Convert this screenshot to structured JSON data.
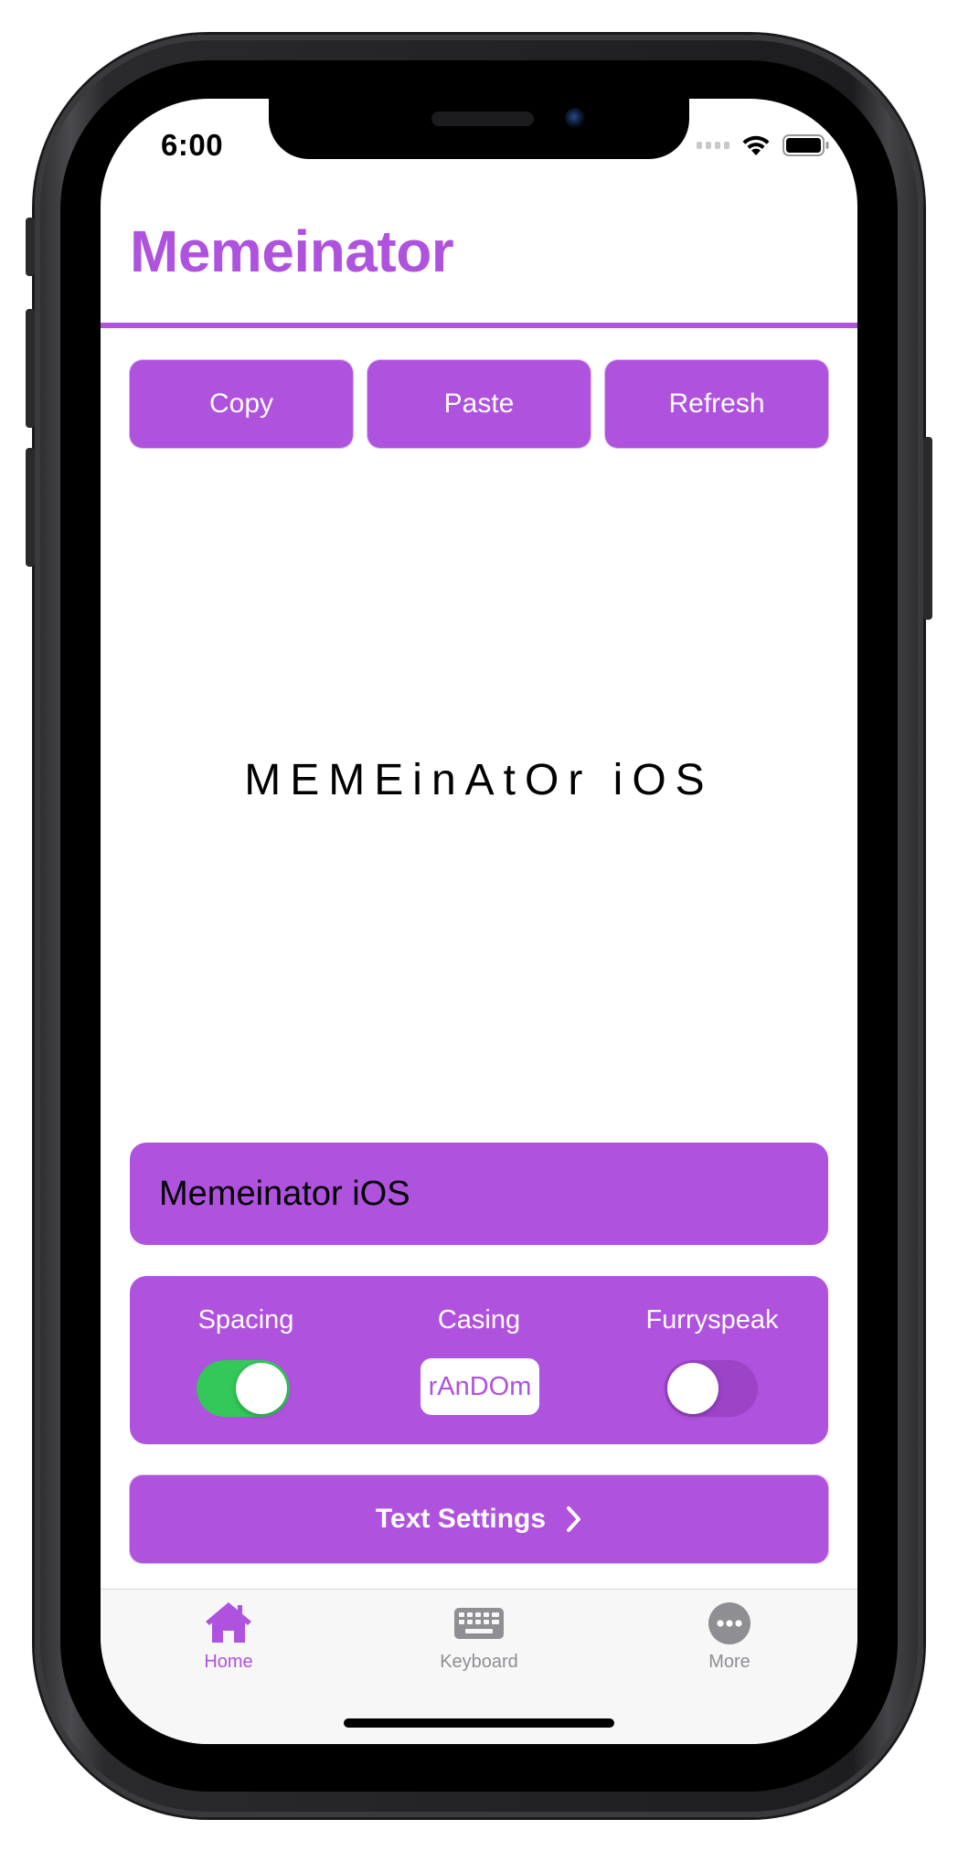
{
  "status_bar": {
    "time": "6:00"
  },
  "app": {
    "title": "Memeinator",
    "accent_color": "#af52de"
  },
  "actions": {
    "copy_label": "Copy",
    "paste_label": "Paste",
    "refresh_label": "Refresh"
  },
  "output": {
    "meme_text": "MEMEinAtOr iOS"
  },
  "input": {
    "value": "Memeinator iOS"
  },
  "options": {
    "spacing": {
      "label": "Spacing",
      "enabled": true,
      "on_color": "#34c759"
    },
    "casing": {
      "label": "Casing",
      "value": "rAnDOm"
    },
    "furryspeak": {
      "label": "Furryspeak",
      "enabled": false
    }
  },
  "settings_button": {
    "label": "Text Settings",
    "icon": "chevron-right-icon"
  },
  "tab_bar": {
    "items": [
      {
        "label": "Home",
        "icon": "house-icon",
        "active": true
      },
      {
        "label": "Keyboard",
        "icon": "keyboard-icon",
        "active": false
      },
      {
        "label": "More",
        "icon": "ellipsis-circle-icon",
        "active": false
      }
    ]
  }
}
